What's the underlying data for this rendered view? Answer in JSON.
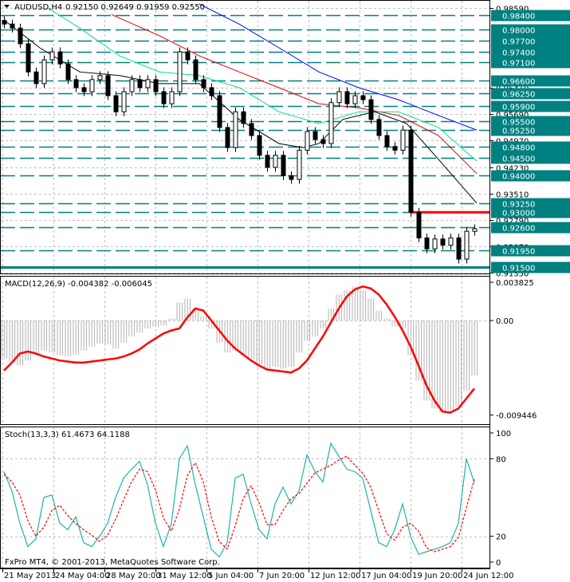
{
  "header": {
    "symbol": "AUDUSD,H4",
    "ohlc": "0.92150 0.92649 0.91959 0.92550"
  },
  "colors": {
    "level": "#008080",
    "resistance": "#ff0000",
    "ma_blue": "#0000ff",
    "ma_red": "#e00000",
    "ma_green": "#00e08a",
    "ma_black": "#000000",
    "macd_hist": "#b0b0b0",
    "macd_signal": "#ff0000",
    "stoch_main": "#20b2aa",
    "stoch_signal": "#ff0000"
  },
  "footer": {
    "copyright": "FxPro MT4, © 2001-2013, MetaQuotes Software Corp."
  },
  "chart_data": [
    {
      "type": "candlestick",
      "title": "AUDUSD,H4",
      "ylim": [
        0.9135,
        0.9859
      ],
      "grid": true,
      "price_ticks": [
        "0.98590",
        "0.96410",
        "0.95690",
        "0.94970",
        "0.94230",
        "0.93510",
        "0.92790",
        "0.92070",
        "0.91350"
      ],
      "levels": [
        {
          "label": "0.98400",
          "value": 0.984
        },
        {
          "label": "0.98000",
          "value": 0.98
        },
        {
          "label": "0.97700",
          "value": 0.977
        },
        {
          "label": "0.97400",
          "value": 0.974
        },
        {
          "label": "0.97100",
          "value": 0.971
        },
        {
          "label": "0.96600",
          "value": 0.966
        },
        {
          "label": "0.96250",
          "value": 0.9625
        },
        {
          "label": "0.95900",
          "value": 0.959
        },
        {
          "label": "0.95500",
          "value": 0.955
        },
        {
          "label": "0.95250",
          "value": 0.9525
        },
        {
          "label": "0.94800",
          "value": 0.948
        },
        {
          "label": "0.94500",
          "value": 0.945
        },
        {
          "label": "0.94000",
          "value": 0.94
        },
        {
          "label": "0.93250",
          "value": 0.9325
        },
        {
          "label": "0.93000",
          "value": 0.93
        },
        {
          "label": "0.92600",
          "value": 0.926
        },
        {
          "label": "0.91950",
          "value": 0.9195
        },
        {
          "label": "0.91500",
          "value": 0.915,
          "solid": true
        }
      ],
      "resistance_line": {
        "value": 0.93,
        "from_index": 51
      },
      "closes": [
        0.9815,
        0.9804,
        0.9761,
        0.9684,
        0.9652,
        0.9717,
        0.9739,
        0.9706,
        0.9663,
        0.9641,
        0.963,
        0.9663,
        0.9674,
        0.9619,
        0.9575,
        0.963,
        0.9663,
        0.9641,
        0.9663,
        0.963,
        0.9597,
        0.963,
        0.9739,
        0.9717,
        0.9663,
        0.9641,
        0.9619,
        0.9532,
        0.9477,
        0.9575,
        0.9543,
        0.951,
        0.9456,
        0.9423,
        0.9456,
        0.94,
        0.939,
        0.947,
        0.9521,
        0.9499,
        0.9488,
        0.96,
        0.963,
        0.9597,
        0.9619,
        0.9608,
        0.9554,
        0.951,
        0.948,
        0.947,
        0.9525,
        0.93,
        0.923,
        0.92,
        0.9227,
        0.921,
        0.923,
        0.9172,
        0.9248,
        0.9255
      ],
      "moving_averages": [
        {
          "color": "ma_blue",
          "points": [
            [
              24.5,
              0.987
            ],
            [
              29.5,
              0.9815
            ],
            [
              34.5,
              0.975
            ],
            [
              39.5,
              0.9684
            ],
            [
              44.5,
              0.9641
            ],
            [
              49.5,
              0.9608
            ],
            [
              54.5,
              0.9565
            ],
            [
              59.3,
              0.9525
            ]
          ]
        },
        {
          "color": "ma_red",
          "points": [
            [
              13.5,
              0.9841
            ],
            [
              19.5,
              0.9783
            ],
            [
              24.5,
              0.9728
            ],
            [
              29.5,
              0.9684
            ],
            [
              34.5,
              0.9641
            ],
            [
              39.5,
              0.9597
            ],
            [
              44.5,
              0.9586
            ],
            [
              49.5,
              0.9565
            ],
            [
              54.5,
              0.951
            ],
            [
              59.3,
              0.9406
            ]
          ]
        },
        {
          "color": "ma_green",
          "points": [
            [
              5.5,
              0.9859
            ],
            [
              9.5,
              0.9804
            ],
            [
              14.5,
              0.9728
            ],
            [
              19.5,
              0.9684
            ],
            [
              24.5,
              0.9674
            ],
            [
              29.5,
              0.9641
            ],
            [
              34.5,
              0.9575
            ],
            [
              39.5,
              0.9543
            ],
            [
              44.5,
              0.9575
            ],
            [
              49.5,
              0.9575
            ],
            [
              54.5,
              0.9532
            ],
            [
              59.3,
              0.944
            ]
          ]
        },
        {
          "color": "ma_black",
          "points": [
            [
              0,
              0.9826
            ],
            [
              4.5,
              0.975
            ],
            [
              9.5,
              0.9684
            ],
            [
              14.5,
              0.9674
            ],
            [
              19.5,
              0.9652
            ],
            [
              24.5,
              0.9652
            ],
            [
              29.5,
              0.9554
            ],
            [
              34.5,
              0.9488
            ],
            [
              37.5,
              0.9477
            ],
            [
              39.5,
              0.9488
            ],
            [
              42.5,
              0.9554
            ],
            [
              46.5,
              0.9575
            ],
            [
              50.5,
              0.9543
            ],
            [
              54.5,
              0.9445
            ],
            [
              59.3,
              0.9325
            ]
          ]
        }
      ],
      "time_labels": [
        "21 May 2013",
        "24 May 04:00",
        "28 May 20:00",
        "31 May 12:00",
        "5 Jun 04:00",
        "7 Jun 20:00",
        "12 Jun 12:00",
        "17 Jun 04:00",
        "19 Jun 20:00",
        "24 Jun 12:00"
      ]
    },
    {
      "type": "bar+line",
      "title": "MACD(12,26,9) -0.004382 -0.006045",
      "ylim": [
        -0.009446,
        0.003825
      ],
      "ticks": [
        "0.003825",
        "0.00",
        "-0.009446"
      ],
      "histogram": [
        -0.0038,
        -0.0042,
        -0.0045,
        -0.004,
        -0.0035,
        -0.003,
        -0.0032,
        -0.0035,
        -0.0036,
        -0.0034,
        -0.003,
        -0.0026,
        -0.0023,
        -0.0024,
        -0.0028,
        -0.0022,
        -0.0016,
        -0.0012,
        -0.0008,
        -0.0006,
        -0.0005,
        0.0002,
        0.0018,
        0.0022,
        0.0012,
        0.0004,
        -0.0008,
        -0.0022,
        -0.0032,
        -0.003,
        -0.0034,
        -0.0038,
        -0.0044,
        -0.0048,
        -0.0046,
        -0.0048,
        -0.0046,
        -0.0032,
        -0.002,
        -0.0016,
        -0.0008,
        0.0012,
        0.0026,
        0.003,
        0.0034,
        0.003,
        0.0022,
        0.001,
        0.0002,
        -0.0006,
        -0.0008,
        -0.0035,
        -0.006,
        -0.008,
        -0.0088,
        -0.0092,
        -0.009,
        -0.0086,
        -0.007,
        -0.0055
      ],
      "signal": [
        -0.005,
        -0.0042,
        -0.0033,
        -0.0031,
        -0.0033,
        -0.0036,
        -0.0038,
        -0.004,
        -0.0041,
        -0.0042,
        -0.0042,
        -0.0041,
        -0.004,
        -0.0039,
        -0.0038,
        -0.0036,
        -0.0033,
        -0.0029,
        -0.0023,
        -0.0018,
        -0.0013,
        -0.001,
        -0.0008,
        0.0003,
        0.0012,
        0.001,
        0.0,
        -0.001,
        -0.002,
        -0.0028,
        -0.0034,
        -0.004,
        -0.0045,
        -0.0049,
        -0.005,
        -0.0051,
        -0.0052,
        -0.0048,
        -0.004,
        -0.0028,
        -0.0016,
        -0.0002,
        0.0012,
        0.0024,
        0.0031,
        0.0034,
        0.0032,
        0.0026,
        0.0016,
        0.0004,
        -0.001,
        -0.0026,
        -0.0045,
        -0.0065,
        -0.008,
        -0.0091,
        -0.0092,
        -0.0088,
        -0.0078,
        -0.0068
      ]
    },
    {
      "type": "line",
      "title": "Stoch(13,3,3) 61.4673 64.1188",
      "ylim": [
        0,
        100
      ],
      "ticks": [
        "100",
        "80",
        "20",
        "0"
      ],
      "main": [
        70,
        55,
        30,
        12,
        18,
        50,
        52,
        30,
        25,
        35,
        15,
        12,
        20,
        30,
        50,
        65,
        72,
        78,
        60,
        30,
        12,
        30,
        80,
        90,
        60,
        35,
        10,
        4,
        15,
        65,
        68,
        45,
        25,
        18,
        45,
        58,
        45,
        55,
        83,
        70,
        62,
        92,
        82,
        72,
        70,
        65,
        40,
        15,
        12,
        25,
        45,
        20,
        6,
        8,
        10,
        12,
        15,
        30,
        80,
        61.4673
      ],
      "signal": [
        68,
        62,
        52,
        32,
        20,
        27,
        40,
        44,
        36,
        30,
        25,
        21,
        16,
        21,
        33,
        48,
        62,
        72,
        70,
        56,
        34,
        24,
        41,
        67,
        77,
        62,
        35,
        16,
        10,
        28,
        49,
        59,
        46,
        29,
        29,
        40,
        49,
        53,
        61,
        69,
        72,
        75,
        79,
        82,
        75,
        69,
        58,
        40,
        22,
        17,
        27,
        30,
        24,
        11,
        8,
        10,
        12,
        19,
        42,
        64.1188
      ]
    }
  ]
}
